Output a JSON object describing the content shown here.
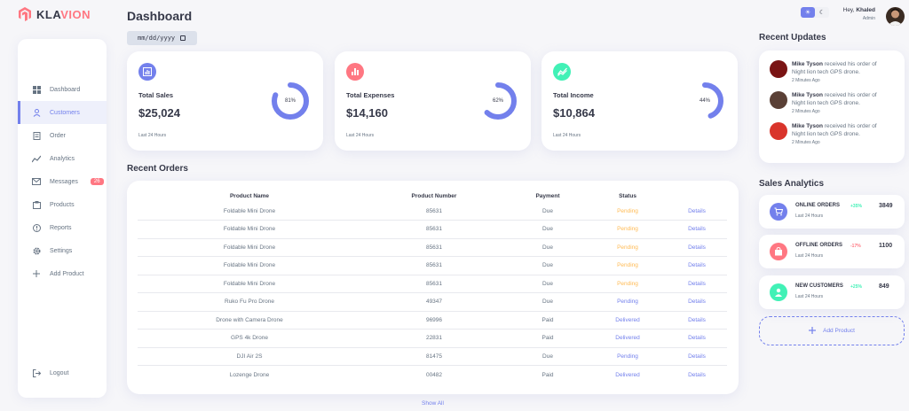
{
  "brand": {
    "name_part1": "KLA",
    "name_part2": "VION"
  },
  "sidebar": {
    "items": [
      {
        "label": "Dashboard",
        "icon": "grid-icon"
      },
      {
        "label": "Customers",
        "icon": "person-icon"
      },
      {
        "label": "Order",
        "icon": "receipt-icon"
      },
      {
        "label": "Analytics",
        "icon": "insights-icon"
      },
      {
        "label": "Messages",
        "icon": "mail-icon",
        "badge": "26"
      },
      {
        "label": "Products",
        "icon": "inventory-icon"
      },
      {
        "label": "Reports",
        "icon": "report-icon"
      },
      {
        "label": "Settings",
        "icon": "gear-icon"
      },
      {
        "label": "Add Product",
        "icon": "plus-icon"
      }
    ],
    "logout": "Logout"
  },
  "main": {
    "title": "Dashboard",
    "date_placeholder": "mm/dd/yyyy",
    "cards": [
      {
        "title": "Total Sales",
        "value": "$25,024",
        "percent": "81%",
        "fraction": 0.81,
        "footer": "Last 24 Hours",
        "color": "#7380ec"
      },
      {
        "title": "Total Expenses",
        "value": "$14,160",
        "percent": "62%",
        "fraction": 0.62,
        "footer": "Last 24 Hours",
        "color": "#ff7782"
      },
      {
        "title": "Total Income",
        "value": "$10,864",
        "percent": "44%",
        "fraction": 0.44,
        "footer": "Last 24 Hours",
        "color": "#41f1b6"
      }
    ],
    "orders_title": "Recent Orders",
    "orders_headers": [
      "Product Name",
      "Product Number",
      "Payment",
      "Status",
      ""
    ],
    "orders": [
      {
        "name": "Foldable Mini Drone",
        "number": "85631",
        "payment": "Due",
        "status": "Pending",
        "action": "Details",
        "kind": "pending"
      },
      {
        "name": "Foldable Mini Drone",
        "number": "85631",
        "payment": "Due",
        "status": "Pending",
        "action": "Details",
        "kind": "pending"
      },
      {
        "name": "Foldable Mini Drone",
        "number": "85631",
        "payment": "Due",
        "status": "Pending",
        "action": "Details",
        "kind": "pending"
      },
      {
        "name": "Foldable Mini Drone",
        "number": "85631",
        "payment": "Due",
        "status": "Pending",
        "action": "Details",
        "kind": "pending"
      },
      {
        "name": "Foldable Mini Drone",
        "number": "85631",
        "payment": "Due",
        "status": "Pending",
        "action": "Details",
        "kind": "pending"
      },
      {
        "name": "Ruko Fu Pro Drone",
        "number": "49347",
        "payment": "Due",
        "status": "Pending",
        "action": "Details",
        "kind": "pending-blue"
      },
      {
        "name": "Drone with Camera Drone",
        "number": "96996",
        "payment": "Paid",
        "status": "Delivered",
        "action": "Details",
        "kind": "delivered"
      },
      {
        "name": "GPS 4k Drone",
        "number": "22831",
        "payment": "Paid",
        "status": "Delivered",
        "action": "Details",
        "kind": "delivered"
      },
      {
        "name": "DJI Air 2S",
        "number": "81475",
        "payment": "Due",
        "status": "Pending",
        "action": "Details",
        "kind": "pending-blue"
      },
      {
        "name": "Lozenge Drone",
        "number": "00482",
        "payment": "Paid",
        "status": "Delivered",
        "action": "Details",
        "kind": "delivered"
      }
    ],
    "show_all": "Show All"
  },
  "topbar": {
    "hey": "Hey,",
    "user_name": "Khaled",
    "role": "Admin"
  },
  "updates": {
    "title": "Recent Updates",
    "items": [
      {
        "name": "Mike Tyson",
        "text": " received his order of Night lion tech GPS drone.",
        "time": "2 Minutes Ago",
        "color": "#7a1414"
      },
      {
        "name": "Mike Tyson",
        "text": " received his order of Night lion tech GPS drone.",
        "time": "2 Minutes Ago",
        "color": "#5a4036"
      },
      {
        "name": "Mike Tyson",
        "text": " received his order of Night lion tech GPS drone.",
        "time": "2 Minutes Ago",
        "color": "#d9342b"
      }
    ]
  },
  "analytics": {
    "title": "Sales Analytics",
    "items": [
      {
        "title": "ONLINE ORDERS",
        "sub": "Last 24 Hours",
        "pct": "+35%",
        "value": "3849",
        "pct_color": "#41f1b6",
        "color": "#7380ec",
        "icon": "cart-icon"
      },
      {
        "title": "OFFLINE ORDERS",
        "sub": "Last 24 Hours",
        "pct": "-17%",
        "value": "1100",
        "pct_color": "#ff7782",
        "color": "#ff7782",
        "icon": "bag-icon"
      },
      {
        "title": "NEW CUSTOMERS",
        "sub": "Last 24 Hours",
        "pct": "+25%",
        "value": "849",
        "pct_color": "#41f1b6",
        "color": "#41f1b6",
        "icon": "person-icon"
      }
    ],
    "add_label": "Add Product"
  }
}
